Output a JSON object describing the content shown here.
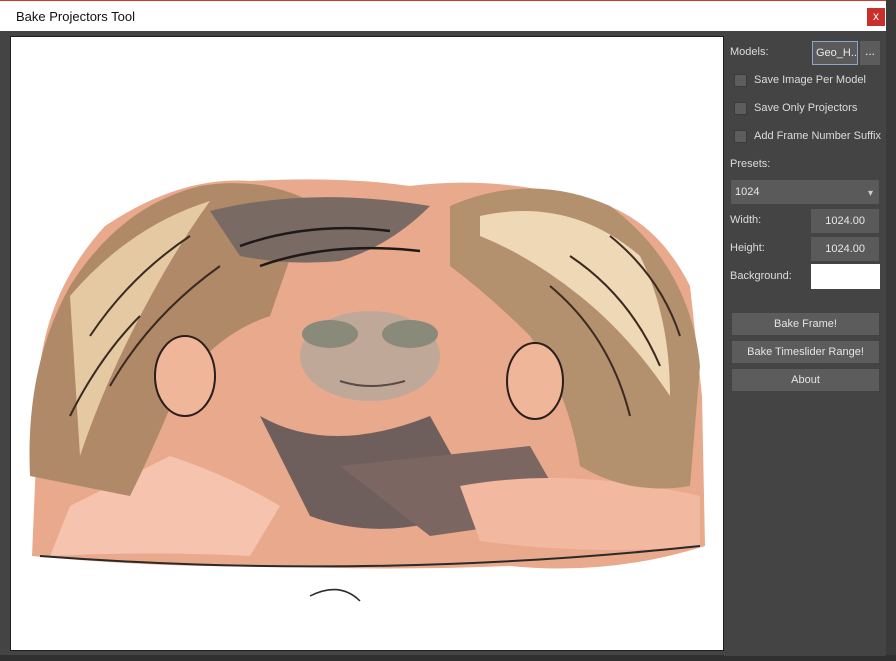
{
  "window": {
    "title": "Bake Projectors Tool",
    "close_label": "x"
  },
  "panel": {
    "models_label": "Models:",
    "models_value": "Geo_H...",
    "models_browse_label": "...",
    "options": [
      {
        "label": "Save Image Per Model",
        "checked": false
      },
      {
        "label": "Save Only Projectors",
        "checked": false
      },
      {
        "label": "Add Frame Number Suffix",
        "checked": false
      }
    ],
    "presets_label": "Presets:",
    "preset_value": "1024",
    "width_label": "Width:",
    "width_value": "1024.00",
    "height_label": "Height:",
    "height_value": "1024.00",
    "background_label": "Background:",
    "background_color": "#ffffff",
    "buttons": {
      "bake_frame": "Bake Frame!",
      "bake_range": "Bake Timeslider Range!",
      "about": "About"
    }
  },
  "colors": {
    "accent_border": "#d8342b",
    "close_button": "#c9302c",
    "panel_bg": "#444444",
    "field_bg": "#5a5a5a"
  }
}
